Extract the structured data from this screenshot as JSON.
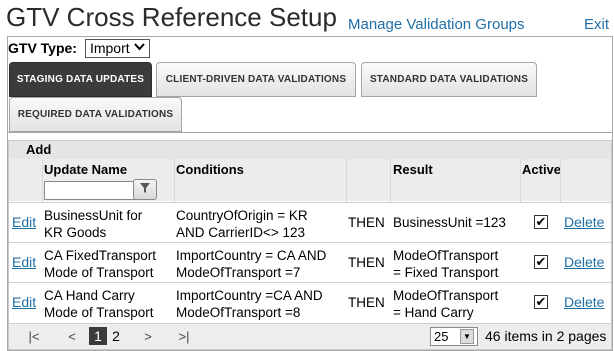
{
  "header": {
    "title": "GTV Cross Reference Setup",
    "manage_link": "Manage Validation Groups",
    "exit_link": "Exit"
  },
  "gtv": {
    "label": "GTV Type:",
    "value": "Import"
  },
  "tabs": [
    {
      "label": "STAGING DATA UPDATES",
      "active": true
    },
    {
      "label": "CLIENT-DRIVEN DATA VALIDATIONS",
      "active": false
    },
    {
      "label": "STANDARD DATA VALIDATIONS",
      "active": false
    },
    {
      "label": "REQUIRED DATA VALIDATIONS",
      "active": false
    }
  ],
  "grid": {
    "add_label": "Add",
    "columns": {
      "update_name": "Update Name",
      "conditions": "Conditions",
      "result": "Result",
      "active": "Active"
    },
    "rows": [
      {
        "edit": "Edit",
        "name_l1": "BusinessUnit for",
        "name_l2": "KR Goods",
        "cond_l1": "CountryOfOrigin = KR",
        "cond_l2": "AND CarrierID<> 123",
        "then": "THEN",
        "res_l1": "BusinessUnit =123",
        "res_l2": "",
        "active": "✔",
        "delete": "Delete"
      },
      {
        "edit": "Edit",
        "name_l1": "CA FixedTransport",
        "name_l2": "Mode of Transport",
        "cond_l1": "ImportCountry = CA AND",
        "cond_l2": "ModeOfTransport =7",
        "then": "THEN",
        "res_l1": "ModeOfTransport",
        "res_l2": "= Fixed Transport",
        "active": "✔",
        "delete": "Delete"
      },
      {
        "edit": "Edit",
        "name_l1": "CA Hand Carry",
        "name_l2": "Mode of Transport",
        "cond_l1": "ImportCountry =CA AND",
        "cond_l2": "ModeOfTransport =8",
        "then": "THEN",
        "res_l1": "ModeOfTransport",
        "res_l2": "= Hand Carry",
        "active": "✔",
        "delete": "Delete"
      }
    ]
  },
  "pager": {
    "first": "|<",
    "prev": "<",
    "pages": [
      "1",
      "2"
    ],
    "current": "1",
    "next": ">",
    "last": ">|",
    "page_size": "25",
    "info": "46 items in 2 pages"
  }
}
